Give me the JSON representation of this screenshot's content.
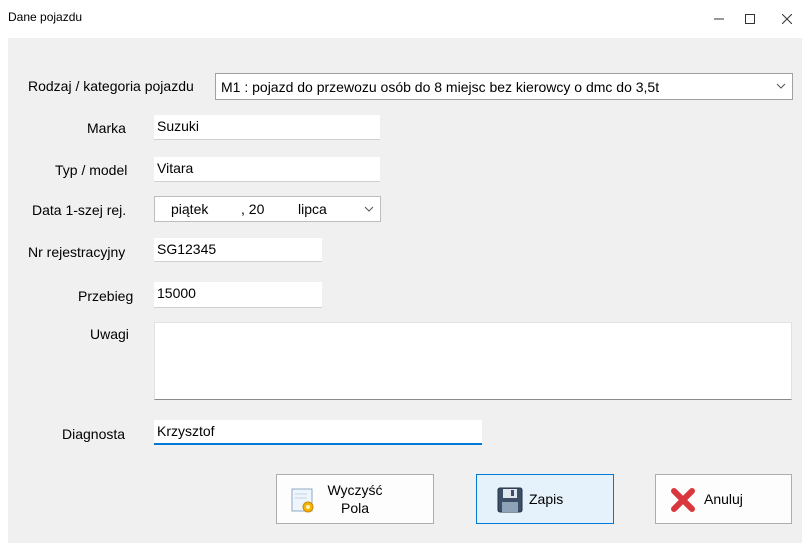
{
  "window": {
    "title": "Dane pojazdu"
  },
  "form": {
    "category": {
      "label": "Rodzaj / kategoria pojazdu",
      "value": "M1 : pojazd do przewozu osób do 8 miejsc bez kierowcy o dmc do 3,5t"
    },
    "make": {
      "label": "Marka",
      "value": "Suzuki"
    },
    "model": {
      "label": "Typ / model",
      "value": "Vitara"
    },
    "reg_date": {
      "label": "Data 1-szej rej.",
      "weekday": "piątek",
      "day": ", 20",
      "month": "lipca"
    },
    "plate": {
      "label": "Nr rejestracyjny",
      "value": "SG12345"
    },
    "mileage": {
      "label": "Przebieg",
      "value": "15000"
    },
    "notes": {
      "label": "Uwagi",
      "value": ""
    },
    "inspector": {
      "label": "Diagnosta",
      "value": "Krzysztof"
    }
  },
  "buttons": {
    "clear_line1": "Wyczyść",
    "clear_line2": "Pola",
    "save": "Zapis",
    "cancel": "Anuluj"
  },
  "icons": {
    "minimize": "minimize-icon",
    "maximize": "maximize-icon",
    "close": "close-icon",
    "clear": "clear-fields-icon",
    "save": "floppy-disk-icon",
    "cancel": "red-x-icon"
  },
  "colors": {
    "focus_underline": "#0078d7",
    "primary_button_border": "#0078d7",
    "cancel_icon": "#d9363e"
  }
}
